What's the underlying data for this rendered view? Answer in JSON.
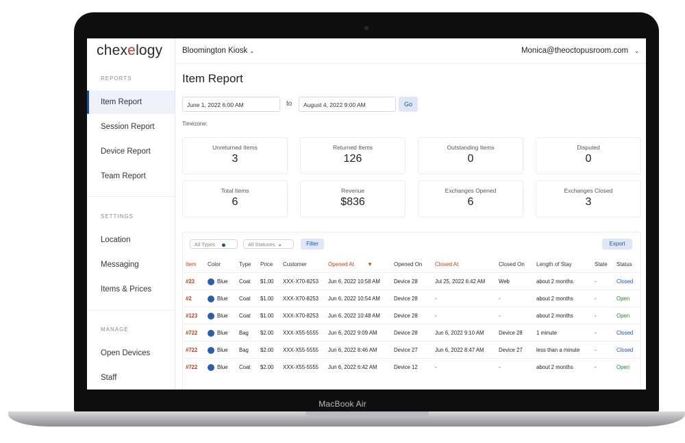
{
  "device": {
    "label": "MacBook Air"
  },
  "app": {
    "logo_prefix": "chex",
    "logo_mid": "e",
    "logo_suffix": "logy",
    "location": "Bloomington Kiosk",
    "user": "Monica@theoctopusroom.com"
  },
  "sidebar": {
    "reports_label": "REPORTS",
    "reports": [
      "Item Report",
      "Session Report",
      "Device Report",
      "Team Report"
    ],
    "settings_label": "SETTINGS",
    "settings": [
      "Location",
      "Messaging",
      "Items & Prices"
    ],
    "manage_label": "MANAGE",
    "manage": [
      "Open Devices",
      "Staff"
    ]
  },
  "page": {
    "title": "Item Report",
    "date_from": "June 1, 2022 6:00 AM",
    "to_label": "to",
    "date_to": "August 4, 2022 9:00 AM",
    "go_label": "Go",
    "timezone_label": "Timezone:"
  },
  "stats": [
    {
      "label": "Unreturned Items",
      "value": "3"
    },
    {
      "label": "Returned Items",
      "value": "126"
    },
    {
      "label": "Outstanding Items",
      "value": "0"
    },
    {
      "label": "Disputed",
      "value": "0"
    },
    {
      "label": "Total Items",
      "value": "6"
    },
    {
      "label": "Revenue",
      "value": "$836"
    },
    {
      "label": "Exchanges Opened",
      "value": "6"
    },
    {
      "label": "Exchanges Closed",
      "value": "3"
    }
  ],
  "table": {
    "type_filter": "All Types",
    "status_filter": "All Statuses",
    "filter_label": "Filter",
    "export_label": "Export",
    "sort_icon": "▼",
    "columns": [
      "Item",
      "Color",
      "Type",
      "Price",
      "Customer",
      "Opened At",
      "Opened On",
      "Closed At",
      "Closed On",
      "Length of Stay",
      "State",
      "Status"
    ],
    "highlight_columns": [
      "Item",
      "Opened At",
      "Closed At"
    ],
    "swatch_color": "#2a5fa8",
    "rows": [
      [
        "#23",
        "Blue",
        "Coat",
        "$1.00",
        "XXX-X70-8253",
        "Jun 6, 2022 10:58 AM",
        "Device 28",
        "Jul 25, 2022 6:42 AM",
        "Web",
        "about 2 months",
        "-",
        "Closed"
      ],
      [
        "#2",
        "Blue",
        "Coat",
        "$1.00",
        "XXX-X70-8253",
        "Jun 6, 2022 10:54 AM",
        "Device 28",
        "-",
        "-",
        "about 2 months",
        "-",
        "Open"
      ],
      [
        "#123",
        "Blue",
        "Coat",
        "$1.00",
        "XXX-X70-8253",
        "Jun 6, 2022 10:48 AM",
        "Device 28",
        "-",
        "-",
        "about 2 months",
        "-",
        "Open"
      ],
      [
        "#722",
        "Blue",
        "Bag",
        "$2.00",
        "XXX-X55-5555",
        "Jun 6, 2022 9:09 AM",
        "Device 28",
        "Jun 6, 2022 9:10 AM",
        "Device 28",
        "1 minute",
        "-",
        "Closed"
      ],
      [
        "#722",
        "Blue",
        "Bag",
        "$2.00",
        "XXX-X55-5555",
        "Jun 6, 2022 8:46 AM",
        "Device 27",
        "Jun 6, 2022 8:47 AM",
        "Device 27",
        "less than a minute",
        "-",
        "Closed"
      ],
      [
        "#722",
        "Blue",
        "Coat",
        "$2.00",
        "XXX-X55-5555",
        "Jun 6, 2022 6:42 AM",
        "Device 12",
        "-",
        "-",
        "about 2 months",
        "-",
        "Open"
      ]
    ]
  }
}
